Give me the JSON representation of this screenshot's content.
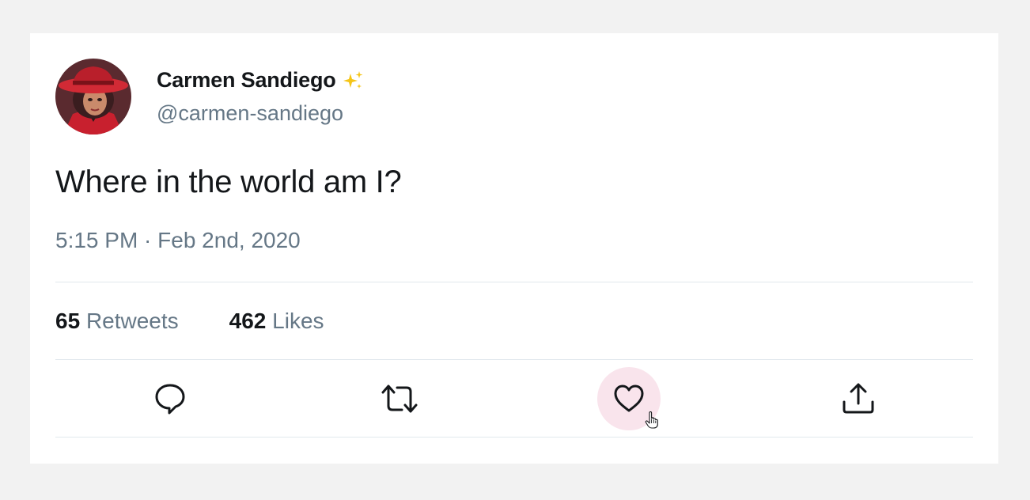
{
  "tweet": {
    "author": {
      "display_name": "Carmen Sandiego",
      "handle": "@carmen-sandiego",
      "badge_icon": "sparkle-icon"
    },
    "text": "Where in the world am I?",
    "timestamp": "5:15 PM · Feb 2nd, 2020",
    "stats": {
      "retweets_count": "65",
      "retweets_label": "Retweets",
      "likes_count": "462",
      "likes_label": "Likes"
    },
    "actions": [
      {
        "name": "reply",
        "icon": "speech-bubble-icon"
      },
      {
        "name": "retweet",
        "icon": "retweet-icon"
      },
      {
        "name": "like",
        "icon": "heart-icon",
        "state": "hovered"
      },
      {
        "name": "share",
        "icon": "share-icon"
      }
    ]
  },
  "colors": {
    "page_background": "#f2f2f2",
    "card_background": "#ffffff",
    "text_primary": "#14171a",
    "text_secondary": "#657786",
    "divider": "#e1e8ed",
    "like_hover": "#f9e4ec",
    "sparkle": "#f5c518"
  }
}
